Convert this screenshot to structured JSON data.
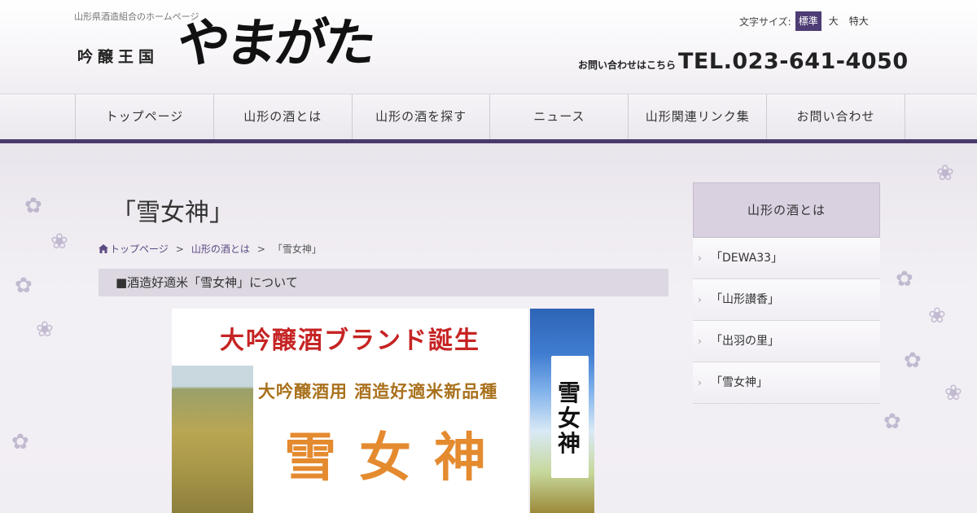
{
  "header": {
    "tagline": "山形県酒造組合のホームページ",
    "logo_small": "吟醸王国",
    "logo_big": "やまがた",
    "font_size": {
      "label": "文字サイズ:",
      "options": [
        "標準",
        "大",
        "特大"
      ],
      "selected": "標準"
    },
    "contact": {
      "lead": "お問い合わせはこちら",
      "tel": "TEL.023-641-4050"
    }
  },
  "nav": {
    "items": [
      "トップページ",
      "山形の酒とは",
      "山形の酒を探す",
      "ニュース",
      "山形関連リンク集",
      "お問い合わせ"
    ]
  },
  "main": {
    "title": "「雪女神」",
    "breadcrumb": {
      "home": "トップページ",
      "parent": "山形の酒とは",
      "current": "「雪女神」",
      "separator": ">"
    },
    "section_heading": "■酒造好適米「雪女神」について",
    "banner": {
      "title": "大吟醸酒ブランド誕生",
      "subtitle": "大吟醸酒用 酒造好適米新品種",
      "name": "雪女神"
    },
    "package": {
      "name": "雪女神"
    }
  },
  "sidebar": {
    "heading": "山形の酒とは",
    "items": [
      "「DEWA33」",
      "「山形讃香」",
      "「出羽の里」",
      "「雪女神」"
    ]
  },
  "colors": {
    "accent": "#4a3a6b",
    "active_button": "#4e3d75",
    "link": "#5b4a82",
    "banner_red": "#c62424",
    "banner_orange": "#e48a2f"
  }
}
